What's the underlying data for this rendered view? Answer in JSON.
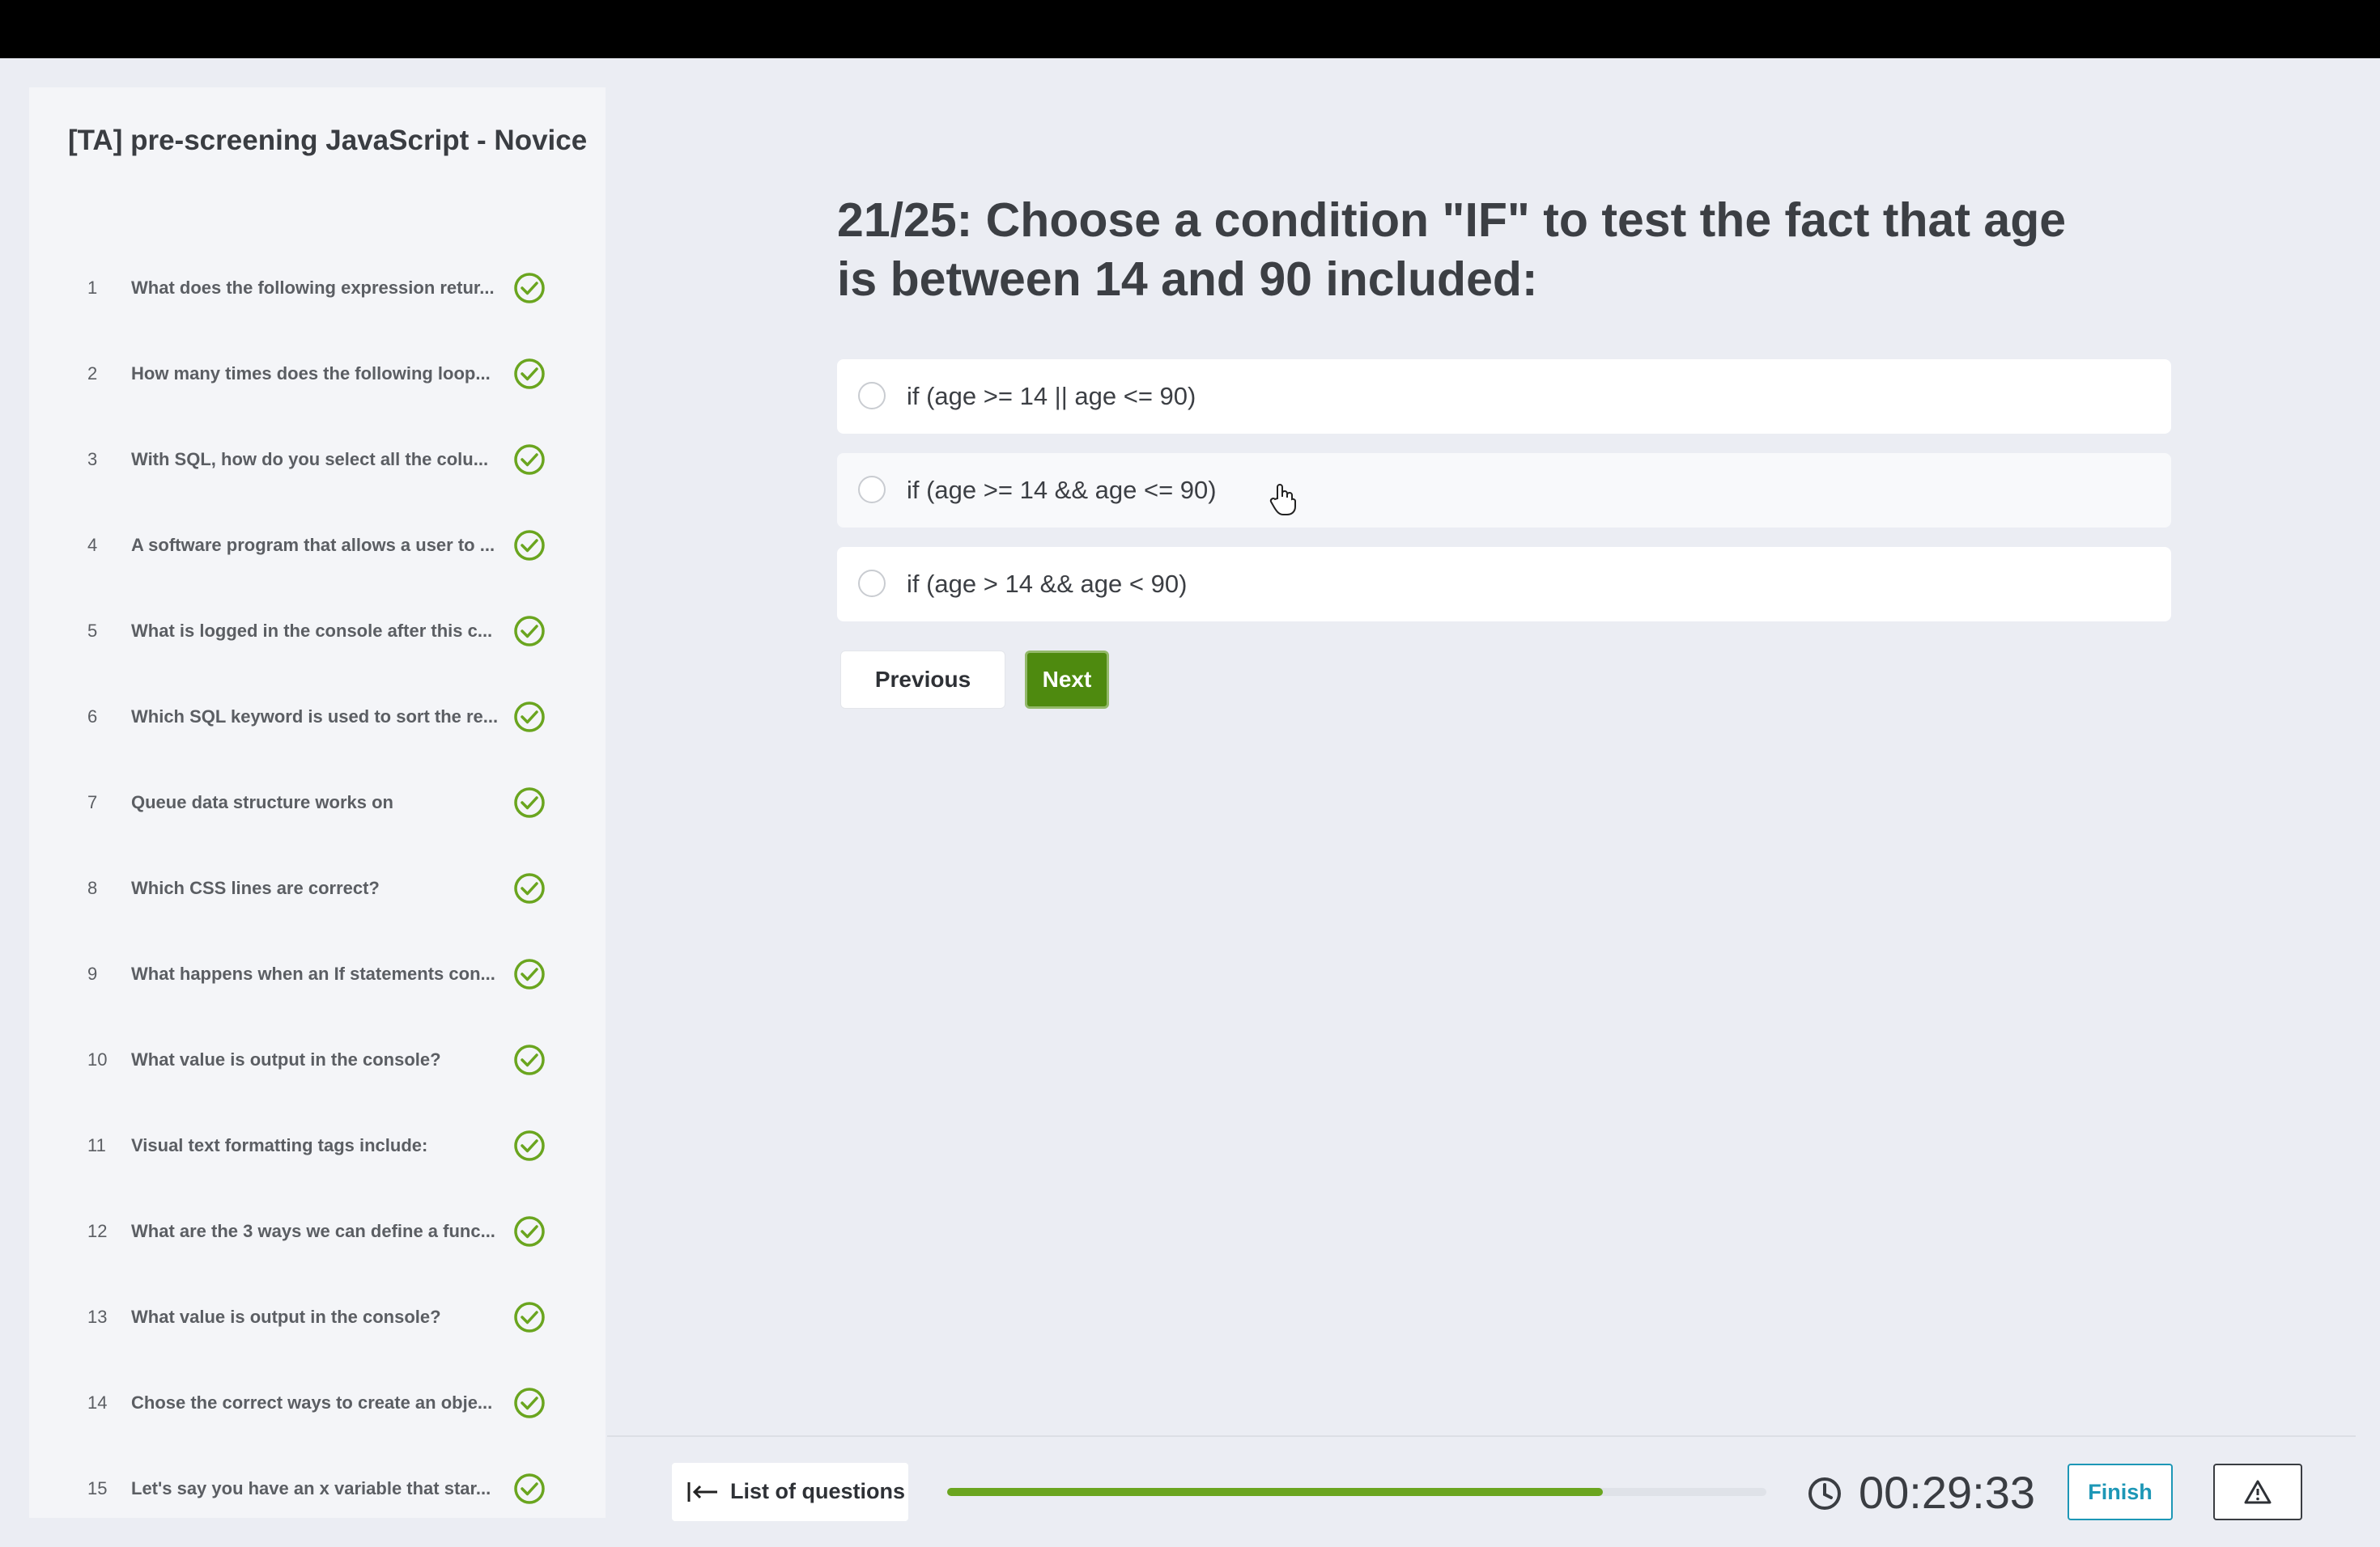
{
  "sidebar": {
    "title": "[TA] pre-screening JavaScript - Novice",
    "questions": [
      {
        "num": "1",
        "text": "What does the following expression retur...",
        "status": "answered"
      },
      {
        "num": "2",
        "text": "How many times does the following loop...",
        "status": "answered"
      },
      {
        "num": "3",
        "text": "With SQL, how do you select all the colu...",
        "status": "answered"
      },
      {
        "num": "4",
        "text": "A software program that allows a user to ...",
        "status": "answered"
      },
      {
        "num": "5",
        "text": "What is logged in the console after this c...",
        "status": "answered"
      },
      {
        "num": "6",
        "text": "Which SQL keyword is used to sort the re...",
        "status": "answered"
      },
      {
        "num": "7",
        "text": "Queue data structure works on",
        "status": "answered"
      },
      {
        "num": "8",
        "text": "Which CSS lines are correct?",
        "status": "answered"
      },
      {
        "num": "9",
        "text": "What happens when an If statements con...",
        "status": "answered"
      },
      {
        "num": "10",
        "text": "What value is output in the console?",
        "status": "answered"
      },
      {
        "num": "11",
        "text": "Visual text formatting tags include:",
        "status": "answered"
      },
      {
        "num": "12",
        "text": "What are the 3 ways we can define a func...",
        "status": "answered"
      },
      {
        "num": "13",
        "text": "What value is output in the console?",
        "status": "answered"
      },
      {
        "num": "14",
        "text": "Chose the correct ways to create an obje...",
        "status": "answered"
      },
      {
        "num": "15",
        "text": "Let's say you have an x variable that star...",
        "status": "answered"
      }
    ]
  },
  "question": {
    "title": "21/25: Choose a condition \"IF\" to test the fact that age is between 14 and 90 included:",
    "options": [
      "if (age >= 14 || age <= 90)",
      "if (age >= 14 && age <= 90)",
      "if (age > 14 && age < 90)"
    ]
  },
  "nav": {
    "previous": "Previous",
    "next": "Next"
  },
  "footer": {
    "list_button": "List of questions",
    "progress": 0.8,
    "timer": "00:29:33",
    "finish": "Finish"
  },
  "colors": {
    "accent_green": "#4e8a0f",
    "check_green": "#6aa51f",
    "finish_blue": "#1d97b6"
  },
  "icons": {
    "check": "check-circle-icon",
    "clock": "clock-icon",
    "report": "warning-triangle-icon",
    "collapse": "arrow-left-bar-icon"
  }
}
